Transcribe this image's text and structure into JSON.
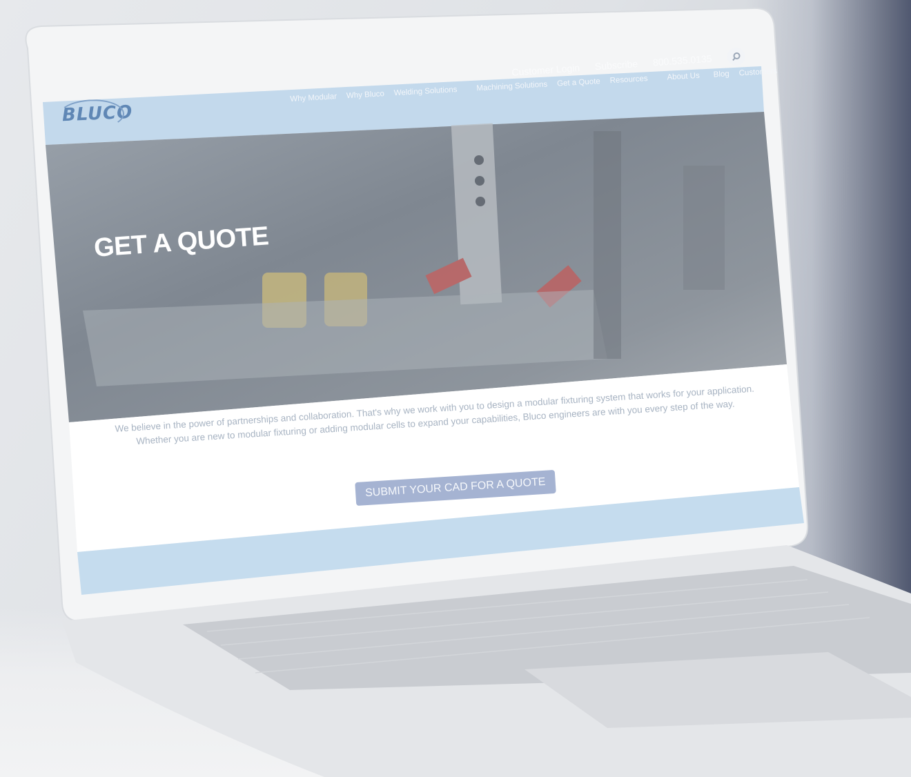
{
  "topbar": {
    "customer_login": "Customer Login",
    "subscribe": "Subscribe",
    "phone": "800.535.0135"
  },
  "logo": {
    "text": "BLUCO"
  },
  "nav": {
    "items": [
      "Why Modular",
      "Why Bluco",
      "Welding Solutions",
      "Machining Solutions",
      "Get a Quote",
      "Resources",
      "About Us",
      "Blog",
      "Customers"
    ]
  },
  "hero": {
    "title": "GET A QUOTE"
  },
  "intro": {
    "line1": "We believe in the power of partnerships and collaboration.  That's why we work with you to design a modular fixturing system that works for your application.",
    "line2": "Whether you are new to modular fixturing or adding modular cells to expand your capabilities, Bluco engineers are with you every step of the way."
  },
  "cta": {
    "label": "SUBMIT YOUR CAD FOR A QUOTE"
  },
  "colors": {
    "header_blue": "#c3d9ec",
    "cta_bg": "#a5b3d2",
    "logo_blue": "#5f87b5"
  }
}
